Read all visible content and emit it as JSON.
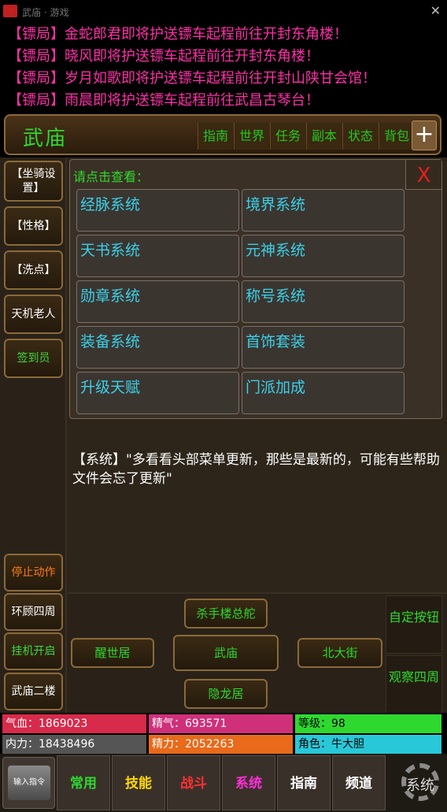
{
  "statusbar": {
    "title": "武庙 · 游戏"
  },
  "news": [
    "【镖局】金蛇郎君即将护送镖车起程前往开封东角楼！",
    "【镖局】晓风即将护送镖车起程前往开封东角楼！",
    "【镖局】岁月如歌即将护送镖车起程前往开封山陕甘会馆！",
    "【镖局】雨晨即将护送镖车起程前往武昌古琴台！"
  ],
  "location": {
    "name": "武庙",
    "nav": [
      "指南",
      "世界",
      "任务",
      "副本",
      "状态",
      "背包"
    ],
    "plus": "+"
  },
  "left_menu": [
    "【坐骑设置】",
    "【性格】",
    "【洗点】",
    "天机老人",
    "签到员"
  ],
  "left_bottom": [
    "停止动作",
    "环顾四周",
    "挂机开启",
    "武庙二楼"
  ],
  "popup": {
    "title": "请点击查看：",
    "close": "X",
    "items": [
      "经脉系统",
      "境界系统",
      "天书系统",
      "元神系统",
      "勋章系统",
      "称号系统",
      "装备系统",
      "首饰套装",
      "升级天赋",
      "门派加成"
    ]
  },
  "system_message": "【系统】\"多看看头部菜单更新，那些是最新的，可能有些帮助文件会忘了更新\"",
  "actions": {
    "north": "杀手楼总舵",
    "west": "醒世居",
    "center": "武庙",
    "east": "北大街",
    "south": "隐龙居",
    "custom": "自定按钮",
    "look": "观察四周"
  },
  "stats": {
    "qixue": "气血：1869023",
    "jingqi": "精气：693571",
    "level": "等级：98",
    "neili": "内力：18438496",
    "jingli": "精力：2052263",
    "role": "角色：牛大胆"
  },
  "tabs": {
    "input": "输入指令",
    "items": [
      "常用",
      "技能",
      "战斗",
      "系统",
      "指南",
      "频道"
    ],
    "settings": "系统"
  },
  "colors": {
    "tab_changyong": "#2fd82f",
    "tab_jineng": "#ffd800",
    "tab_zhandou": "#ff3030",
    "tab_xitong": "#ff2fd8",
    "tab_zhinan": "#ffffff",
    "tab_pindao": "#ffffff",
    "stat_qixue": "#d82a4a",
    "stat_jingqi": "#d0307a",
    "stat_level": "#2fd82f",
    "stat_neili": "#555555",
    "stat_jingli": "#e86a1a",
    "stat_role": "#28c8d8"
  }
}
